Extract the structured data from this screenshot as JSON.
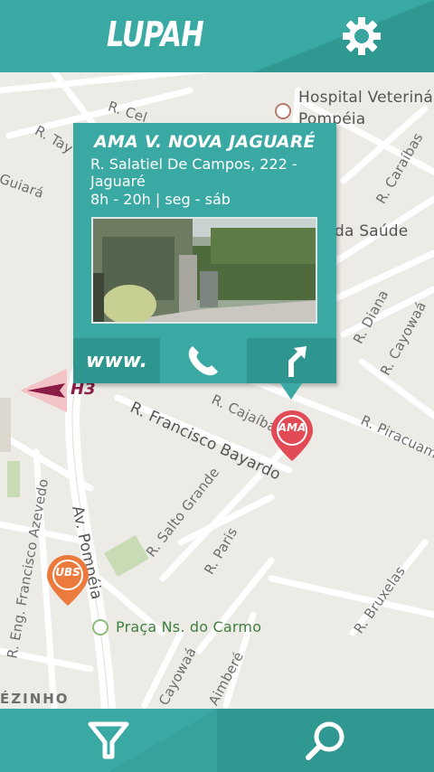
{
  "app": {
    "title": "LUPAH"
  },
  "header": {
    "settings_icon": "gear-icon"
  },
  "map": {
    "streets": [
      "Hospital Veterinário",
      "Pompéia",
      "R. Cel",
      "R. Tay",
      "Guiará",
      "R. Caraíbas",
      "da Saúde",
      "R. Diana",
      "R. Cayowaá",
      "R. Cajaíba",
      "R. Francisco Bayardo",
      "R. Piracuama",
      "Av. Pompéia",
      "R. Eng. Francisco Azevedo",
      "R. Salto Grande",
      "R. Paris",
      "R. Bruxelas",
      "Praça Ns. do Carmo",
      "Cayowaá",
      "Aimberé",
      "ÉZINHO",
      "H3"
    ],
    "markers": [
      {
        "label": "AMA",
        "color": "#e24a56"
      },
      {
        "label": "UBS",
        "color": "#ec7a3c"
      }
    ]
  },
  "popup": {
    "title": "AMA V. NOVA JAGUARÉ",
    "address": "R. Salatiel De Campos, 222 - Jaguaré",
    "hours": "8h - 20h | seg - sáb",
    "actions": {
      "web_label": "www.",
      "phone_icon": "phone-icon",
      "directions_icon": "directions-icon"
    }
  },
  "footer": {
    "filter_icon": "filter-icon",
    "search_icon": "search-icon"
  },
  "colors": {
    "primary": "#3aa9a3",
    "primary_dark": "#2f958f",
    "ama_marker": "#e24a56",
    "ubs_marker": "#ec7a3c"
  }
}
